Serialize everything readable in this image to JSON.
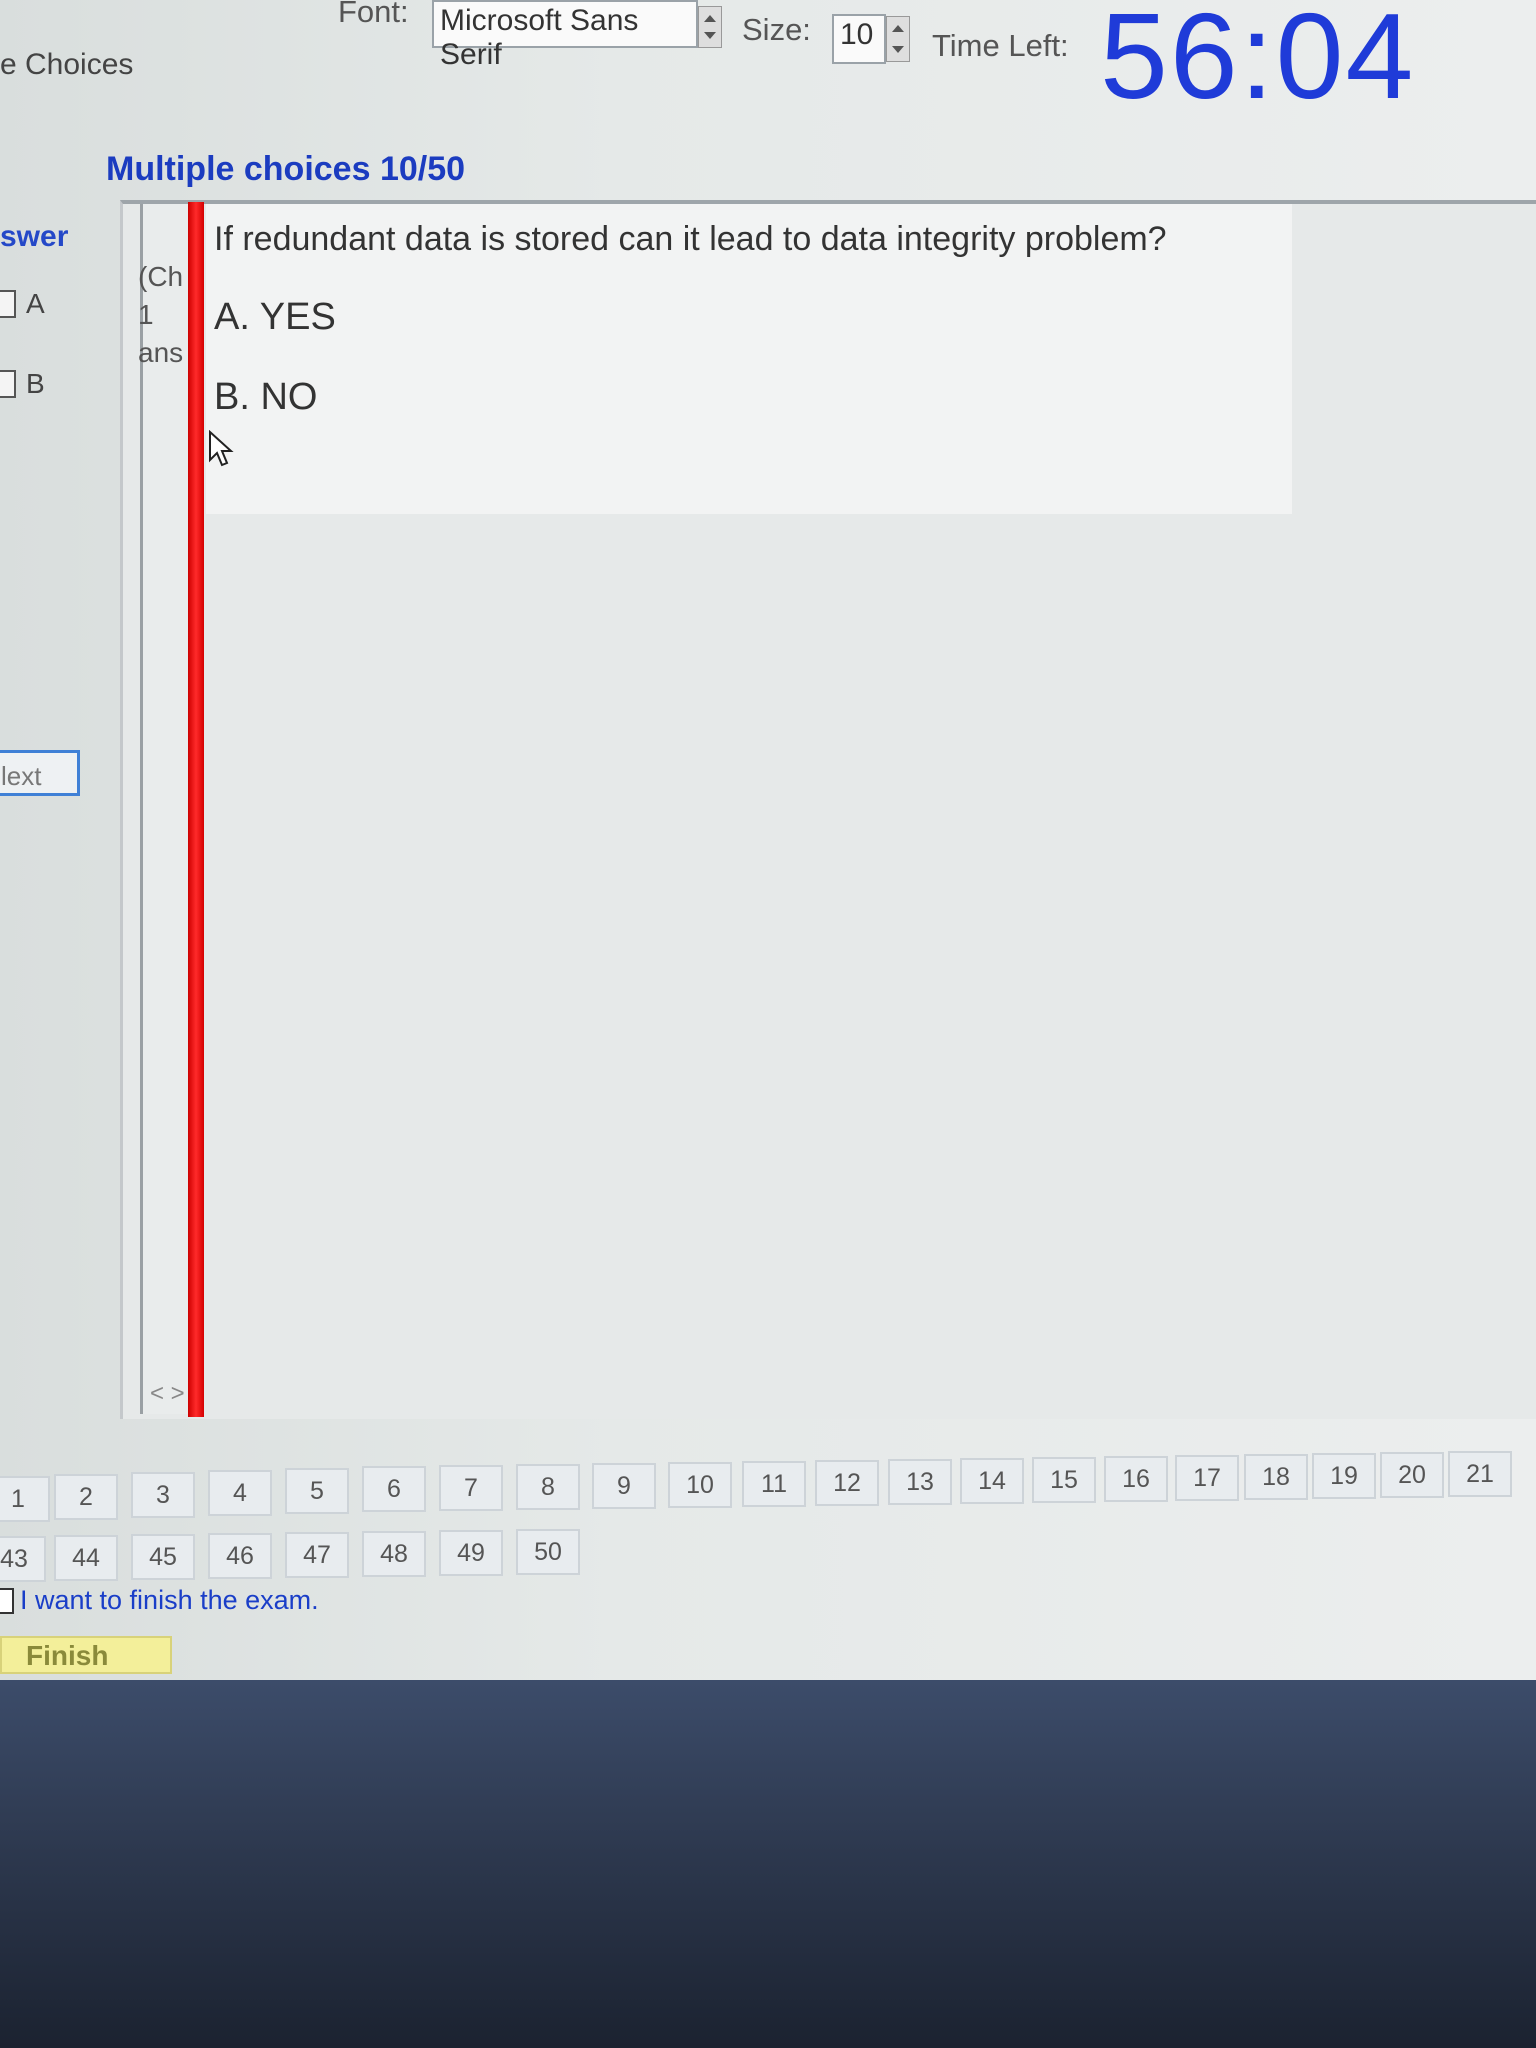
{
  "toolbar": {
    "font_label": "Font:",
    "font_value": "Microsoft Sans Serif",
    "size_label": "Size:",
    "size_value": "10",
    "time_left_label": "Time Left:",
    "timer": "56:04"
  },
  "tab_label": "e Choices",
  "section_title": "Multiple choices 10/50",
  "answer_panel": {
    "label": "swer",
    "options": [
      "A",
      "B"
    ],
    "next_label": "lext"
  },
  "narrow_panel": {
    "line1": "(Ch",
    "line2": "1",
    "line3": "ans",
    "arrows": "< >"
  },
  "question": {
    "text": "If redundant data is stored can it lead to data integrity problem?",
    "choices": [
      "A. YES",
      "B. NO"
    ]
  },
  "question_nav": {
    "row1": [
      "1",
      "2",
      "3",
      "4",
      "5",
      "6",
      "7",
      "8",
      "9",
      "10",
      "11",
      "12",
      "13",
      "14",
      "15",
      "16",
      "17",
      "18",
      "19",
      "20",
      "21"
    ],
    "row2": [
      "43",
      "44",
      "45",
      "46",
      "47",
      "48",
      "49",
      "50"
    ]
  },
  "finish": {
    "checkbox_label": "I want to finish the exam.",
    "button_label": "Finish"
  },
  "colors": {
    "timer": "#1f3bd8",
    "title": "#1b3cc0",
    "red_bar": "#ff2a2a",
    "finish_button": "#f3ef9a"
  }
}
